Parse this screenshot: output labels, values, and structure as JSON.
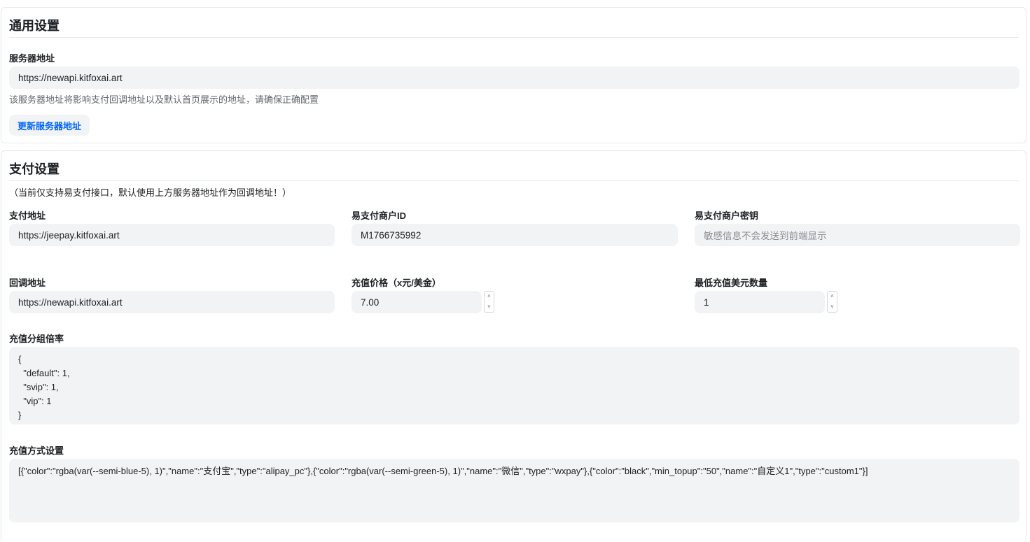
{
  "general": {
    "title": "通用设置",
    "server_address_label": "服务器地址",
    "server_address_value": "https://newapi.kitfoxai.art",
    "server_address_hint": "该服务器地址将影响支付回调地址以及默认首页展示的地址，请确保正确配置",
    "update_button_label": "更新服务器地址"
  },
  "payment": {
    "title": "支付设置",
    "note": "（当前仅支持易支付接口，默认使用上方服务器地址作为回调地址！）",
    "pay_address_label": "支付地址",
    "pay_address_value": "https://jeepay.kitfoxai.art",
    "merchant_id_label": "易支付商户ID",
    "merchant_id_value": "M1766735992",
    "merchant_key_label": "易支付商户密钥",
    "merchant_key_placeholder": "敏感信息不会发送到前端显示",
    "callback_label": "回调地址",
    "callback_value": "https://newapi.kitfoxai.art",
    "price_label": "充值价格（x元/美金）",
    "price_value": "7.00",
    "min_topup_label": "最低充值美元数量",
    "min_topup_value": "1",
    "group_ratio_label": "充值分组倍率",
    "group_ratio_value": "{\n  \"default\": 1,\n  \"svip\": 1,\n  \"vip\": 1\n}",
    "methods_label": "充值方式设置",
    "methods_value": "[{\"color\":\"rgba(var(--semi-blue-5), 1)\",\"name\":\"支付宝\",\"type\":\"alipay_pc\"},{\"color\":\"rgba(var(--semi-green-5), 1)\",\"name\":\"微信\",\"type\":\"wxpay\"},{\"color\":\"black\",\"min_topup\":\"50\",\"name\":\"自定义1\",\"type\":\"custom1\"}]"
  },
  "icons": {
    "stepper_up": "chevron-up-icon",
    "stepper_down": "chevron-down-icon"
  },
  "colors": {
    "accent": "#0064fa",
    "field_bg": "#f2f3f5",
    "border": "#e6e8ea"
  }
}
